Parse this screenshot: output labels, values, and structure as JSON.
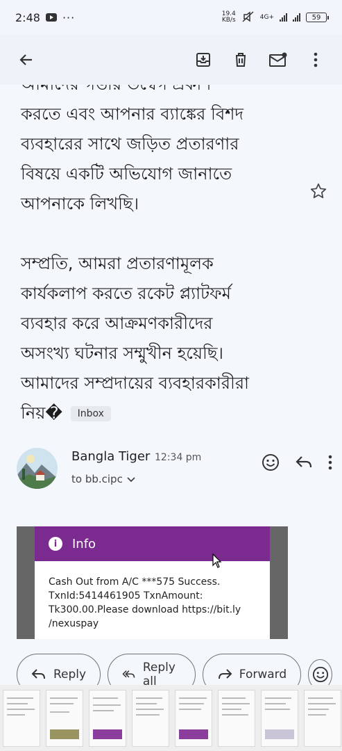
{
  "status": {
    "time": "2:48",
    "net_speed": "19.4 KB/s",
    "network": "4G+",
    "battery": "59"
  },
  "app_bar": {
    "back_icon": "arrow-back-icon",
    "archive_icon": "archive-icon",
    "delete_icon": "trash-icon",
    "mark_unread_icon": "mail-unread-icon",
    "more_icon": "more-vert-icon"
  },
  "message": {
    "partial_first_line": "আমাদের গভীর উদ্বেগ প্রকাশ",
    "paragraph_1_lines": [
      "করতে এবং আপনার ব্যাঙ্কের বিশদ",
      "ব্যবহারের সাথে জড়িত প্রতারণার",
      "বিষয়ে একটি অভিযোগ জানাতে",
      "আপনাকে লিখছি।"
    ],
    "paragraph_2_lines": [
      "সম্প্রতি, আমরা প্রতারণামূলক",
      "কার্যকলাপ করতে রকেট প্ল্যাটফর্ম",
      "ব্যবহার করে আক্রমণকারীদের",
      "অসংখ্য ঘটনার সম্মুখীন হয়েছি।",
      "আমাদের সম্প্রদায়ের ব্যবহারকারীরা",
      "নিয়�"
    ],
    "label_chip": "Inbox"
  },
  "sender": {
    "name": "Bangla Tiger",
    "time": "12:34 pm",
    "to": "to bb.cipc"
  },
  "attachment": {
    "header": "Info",
    "text": "Cash Out from A/C ***575 Success. TxnId:5414461905 TxnAmount: Tk300.00.Please download https://bit.ly /nexuspay"
  },
  "actions": {
    "reply": "Reply",
    "reply_all": "Reply all",
    "forward": "Forward"
  },
  "colors": {
    "accent_purple": "#7b2a8f",
    "background": "#f4f8fd"
  }
}
